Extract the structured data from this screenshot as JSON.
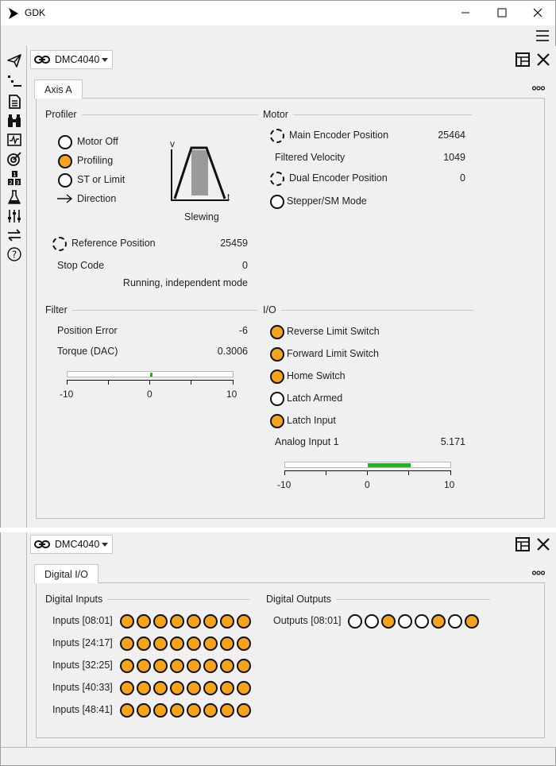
{
  "app": {
    "title": "GDK"
  },
  "top_panel": {
    "controller": "DMC4040",
    "tab": "Axis A",
    "profiler": {
      "title": "Profiler",
      "status": [
        {
          "label": "Motor Off",
          "state": "off"
        },
        {
          "label": "Profiling",
          "state": "on"
        },
        {
          "label": "ST or Limit",
          "state": "off"
        }
      ],
      "direction_label": "Direction",
      "velocity_axis": "v",
      "time_axis": "t",
      "profile_state": "Slewing",
      "reference_position_label": "Reference Position",
      "reference_position_value": "25459",
      "stop_code_label": "Stop Code",
      "stop_code_value": "0",
      "mode_text": "Running, independent mode"
    },
    "motor": {
      "title": "Motor",
      "main_encoder_label": "Main Encoder Position",
      "main_encoder_value": "25464",
      "filtered_velocity_label": "Filtered Velocity",
      "filtered_velocity_value": "1049",
      "dual_encoder_label": "Dual Encoder Position",
      "dual_encoder_value": "0",
      "stepper_label": "Stepper/SM Mode"
    },
    "filter": {
      "title": "Filter",
      "position_error_label": "Position Error",
      "position_error_value": "-6",
      "torque_label": "Torque (DAC)",
      "torque_value": "0.3006",
      "scale_min": "-10",
      "scale_mid": "0",
      "scale_max": "10"
    },
    "io": {
      "title": "I/O",
      "signals": [
        {
          "label": "Reverse Limit Switch",
          "state": "on"
        },
        {
          "label": "Forward Limit Switch",
          "state": "on"
        },
        {
          "label": "Home Switch",
          "state": "on"
        },
        {
          "label": "Latch Armed",
          "state": "off"
        },
        {
          "label": "Latch Input",
          "state": "on"
        }
      ],
      "analog_label": "Analog Input 1",
      "analog_value": "5.171",
      "scale_min": "-10",
      "scale_mid": "0",
      "scale_max": "10"
    }
  },
  "bottom_panel": {
    "controller": "DMC4040",
    "tab": "Digital I/O",
    "inputs_title": "Digital Inputs",
    "outputs_title": "Digital Outputs",
    "inputs": [
      {
        "label": "Inputs [08:01]",
        "bits": [
          1,
          1,
          1,
          1,
          1,
          1,
          1,
          1
        ]
      },
      {
        "label": "Inputs [24:17]",
        "bits": [
          1,
          1,
          1,
          1,
          1,
          1,
          1,
          1
        ]
      },
      {
        "label": "Inputs [32:25]",
        "bits": [
          1,
          1,
          1,
          1,
          1,
          1,
          1,
          1
        ]
      },
      {
        "label": "Inputs [40:33]",
        "bits": [
          1,
          1,
          1,
          1,
          1,
          1,
          1,
          1
        ]
      },
      {
        "label": "Inputs [48:41]",
        "bits": [
          1,
          1,
          1,
          1,
          1,
          1,
          1,
          1
        ]
      }
    ],
    "outputs": [
      {
        "label": "Outputs [08:01]",
        "bits": [
          0,
          0,
          1,
          0,
          0,
          1,
          0,
          1
        ]
      }
    ]
  },
  "colors": {
    "led_on": "#f5a31b",
    "bar_fill": "#10c010"
  }
}
